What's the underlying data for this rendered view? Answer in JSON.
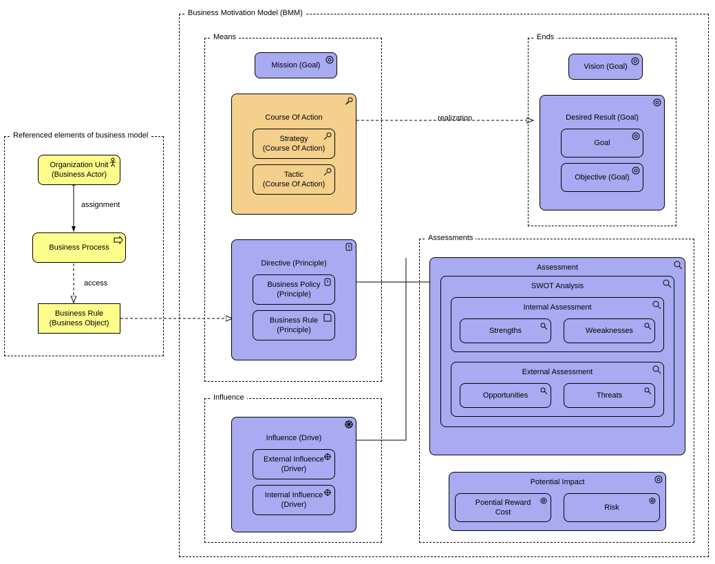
{
  "groups": {
    "referenced": "Referenced elements of business model",
    "bmm": "Business Motivation Model (BMM)",
    "means": "Means",
    "ends": "Ends",
    "influence": "Influence",
    "assessments": "Assessments"
  },
  "nodes": {
    "orgUnit": "Organization Unit\n(Business Actor)",
    "businessProcess": "Business Process",
    "businessRule": "Business Rule\n(Business Object)",
    "mission": "Mission (Goal)",
    "courseOfAction": "Course Of Action",
    "strategy": "Strategy\n(Course Of Action)",
    "tactic": "Tactic\n(Course Of Action)",
    "directive": "Directive (Principle)",
    "businessPolicy": "Business Policy\n(Principle)",
    "businessRulePrinciple": "Business Rule\n(Principle)",
    "influenceDrive": "Influence (Drive)",
    "externalInfluence": "External Influence\n(Driver)",
    "internalInfluence": "Internal Influence\n(Driver)",
    "vision": "Vision (Goal)",
    "desiredResult": "Desired Result (Goal)",
    "goal": "Goal",
    "objective": "Objective (Goal)",
    "assessment": "Assessment",
    "swot": "SWOT Analysis",
    "internalAssessment": "Internal Assessment",
    "externalAssessment": "External Assessment",
    "strengths": "Strengths",
    "weaknesses": "Weeaknesses",
    "opportunities": "Opportunities",
    "threats": "Threats",
    "potentialImpact": "Potential Impact",
    "potentialReward": "Poential Reward\nCost",
    "risk": "Risk"
  },
  "edges": {
    "assignment": "assignment",
    "access": "access",
    "realization": "realization"
  },
  "chart_data": {
    "type": "diagram",
    "diagram_type": "ArchiMate Business Motivation Model",
    "groups": [
      {
        "id": "referenced",
        "label": "Referenced elements of business model",
        "contains": [
          "orgUnit",
          "businessProcess",
          "businessRule"
        ]
      },
      {
        "id": "bmm",
        "label": "Business Motivation Model (BMM)",
        "contains": [
          "means",
          "ends",
          "influence",
          "assessments"
        ]
      },
      {
        "id": "means",
        "label": "Means",
        "contains": [
          "mission",
          "courseOfAction",
          "directive"
        ]
      },
      {
        "id": "ends",
        "label": "Ends",
        "contains": [
          "vision",
          "desiredResult"
        ]
      },
      {
        "id": "influence",
        "label": "Influence",
        "contains": [
          "influenceDrive"
        ]
      },
      {
        "id": "assessments",
        "label": "Assessments",
        "contains": [
          "assessment",
          "potentialImpact"
        ]
      }
    ],
    "elements": [
      {
        "id": "orgUnit",
        "label": "Organization Unit (Business Actor)",
        "type": "business-actor",
        "color": "yellow"
      },
      {
        "id": "businessProcess",
        "label": "Business Process",
        "type": "business-process",
        "color": "yellow"
      },
      {
        "id": "businessRule",
        "label": "Business Rule (Business Object)",
        "type": "business-object",
        "color": "yellow"
      },
      {
        "id": "mission",
        "label": "Mission (Goal)",
        "type": "goal",
        "color": "blue"
      },
      {
        "id": "courseOfAction",
        "label": "Course Of Action",
        "type": "course-of-action",
        "color": "orange",
        "children": [
          "strategy",
          "tactic"
        ]
      },
      {
        "id": "strategy",
        "label": "Strategy (Course Of Action)",
        "type": "course-of-action",
        "color": "orange"
      },
      {
        "id": "tactic",
        "label": "Tactic (Course Of Action)",
        "type": "course-of-action",
        "color": "orange"
      },
      {
        "id": "directive",
        "label": "Directive (Principle)",
        "type": "principle",
        "color": "blue",
        "children": [
          "businessPolicy",
          "businessRulePrinciple"
        ]
      },
      {
        "id": "businessPolicy",
        "label": "Business Policy (Principle)",
        "type": "principle",
        "color": "blue"
      },
      {
        "id": "businessRulePrinciple",
        "label": "Business Rule (Principle)",
        "type": "principle",
        "color": "blue"
      },
      {
        "id": "influenceDrive",
        "label": "Influence (Drive)",
        "type": "driver",
        "color": "blue",
        "children": [
          "externalInfluence",
          "internalInfluence"
        ]
      },
      {
        "id": "externalInfluence",
        "label": "External Influence (Driver)",
        "type": "driver",
        "color": "blue"
      },
      {
        "id": "internalInfluence",
        "label": "Internal Influence (Driver)",
        "type": "driver",
        "color": "blue"
      },
      {
        "id": "vision",
        "label": "Vision (Goal)",
        "type": "goal",
        "color": "blue"
      },
      {
        "id": "desiredResult",
        "label": "Desired Result (Goal)",
        "type": "goal",
        "color": "blue",
        "children": [
          "goal",
          "objective"
        ]
      },
      {
        "id": "goal",
        "label": "Goal",
        "type": "goal",
        "color": "blue"
      },
      {
        "id": "objective",
        "label": "Objective (Goal)",
        "type": "goal",
        "color": "blue"
      },
      {
        "id": "assessment",
        "label": "Assessment",
        "type": "assessment",
        "color": "blue",
        "children": [
          "swot"
        ]
      },
      {
        "id": "swot",
        "label": "SWOT Analysis",
        "type": "assessment",
        "color": "blue",
        "children": [
          "internalAssessment",
          "externalAssessment"
        ]
      },
      {
        "id": "internalAssessment",
        "label": "Internal Assessment",
        "type": "assessment",
        "color": "blue",
        "children": [
          "strengths",
          "weaknesses"
        ]
      },
      {
        "id": "externalAssessment",
        "label": "External Assessment",
        "type": "assessment",
        "color": "blue",
        "children": [
          "opportunities",
          "threats"
        ]
      },
      {
        "id": "strengths",
        "label": "Strengths",
        "type": "assessment",
        "color": "blue"
      },
      {
        "id": "weaknesses",
        "label": "Weeaknesses",
        "type": "assessment",
        "color": "blue"
      },
      {
        "id": "opportunities",
        "label": "Opportunities",
        "type": "assessment",
        "color": "blue"
      },
      {
        "id": "threats",
        "label": "Threats",
        "type": "assessment",
        "color": "blue"
      },
      {
        "id": "potentialImpact",
        "label": "Potential Impact",
        "type": "goal",
        "color": "blue",
        "children": [
          "potentialReward",
          "risk"
        ]
      },
      {
        "id": "potentialReward",
        "label": "Poential Reward Cost",
        "type": "goal",
        "color": "blue"
      },
      {
        "id": "risk",
        "label": "Risk",
        "type": "goal",
        "color": "blue"
      }
    ],
    "relationships": [
      {
        "from": "orgUnit",
        "to": "businessProcess",
        "type": "assignment",
        "label": "assignment"
      },
      {
        "from": "businessProcess",
        "to": "businessRule",
        "type": "access",
        "label": "access"
      },
      {
        "from": "businessRule",
        "to": "directive",
        "type": "realization",
        "label": ""
      },
      {
        "from": "courseOfAction",
        "to": "desiredResult",
        "type": "realization",
        "label": "realization"
      },
      {
        "from": "directive",
        "to": "assessments",
        "type": "association",
        "label": ""
      },
      {
        "from": "influenceDrive",
        "to": "assessments",
        "type": "association",
        "label": ""
      }
    ]
  }
}
